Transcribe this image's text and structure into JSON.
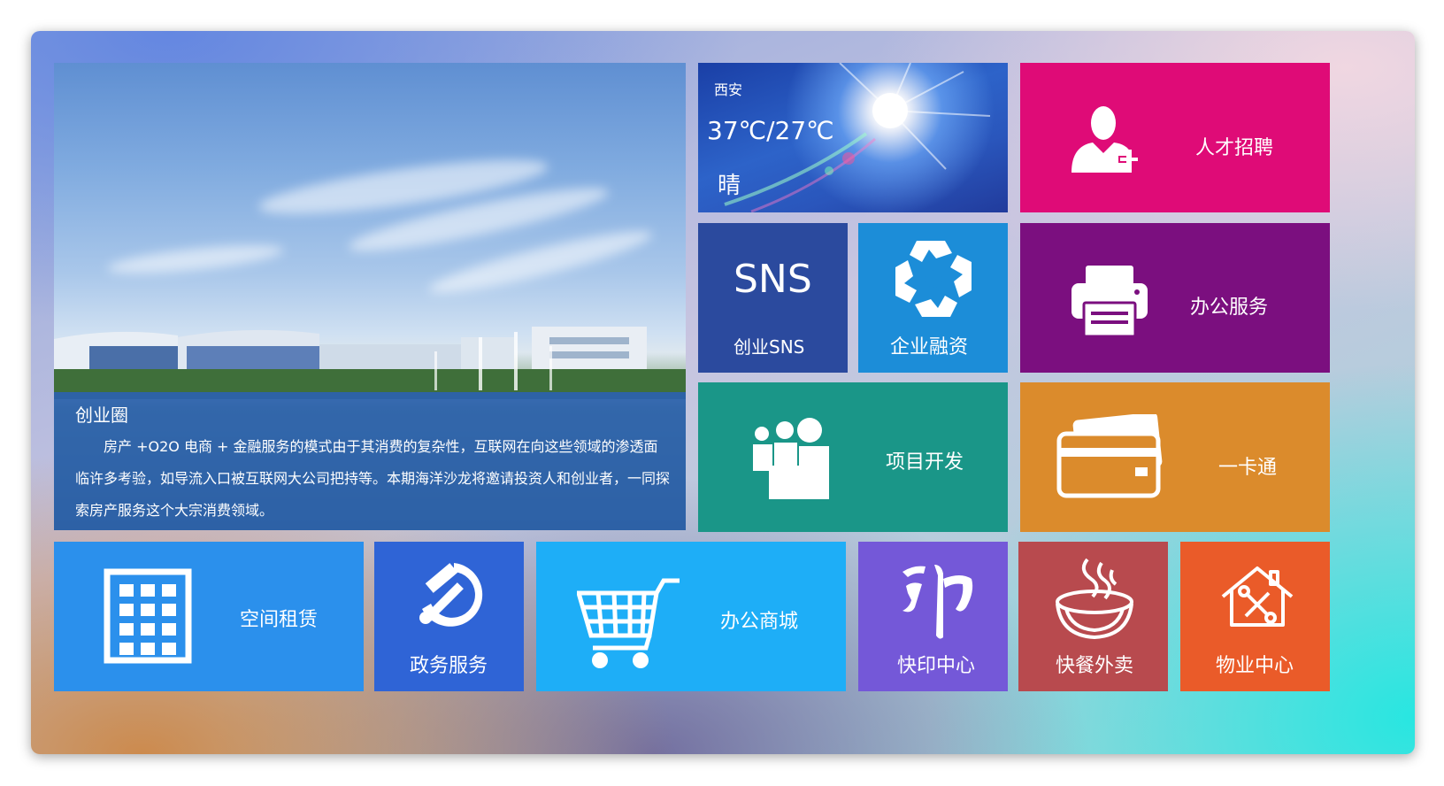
{
  "hero": {
    "title": "创业圈",
    "body": "房产 +O2O 电商 + 金融服务的模式由于其消费的复杂性，互联网在向这些领域的渗透面临许多考验，如导流入口被互联网大公司把持等。本期海洋沙龙将邀请投资人和创业者，一同探索房产服务这个大宗消费领域。"
  },
  "weather": {
    "city": "西安",
    "temp": "37℃/27℃",
    "condition": "晴"
  },
  "tiles": {
    "talent": {
      "label": "人才招聘",
      "icon": "user-add-icon",
      "color": "#df0b77"
    },
    "sns": {
      "big": "SNS",
      "label": "创业SNS",
      "color": "#2b4a9e"
    },
    "finance": {
      "label": "企业融资",
      "icon": "handshake-icon",
      "color": "#1c8dd8"
    },
    "office_service": {
      "label": "办公服务",
      "icon": "printer-icon",
      "color": "#7b0f7f"
    },
    "project": {
      "label": "项目开发",
      "icon": "people-group-icon",
      "color": "#1a9688"
    },
    "card": {
      "label": "一卡通",
      "icon": "card-icon",
      "color": "#db8b2c"
    },
    "rental": {
      "label": "空间租赁",
      "icon": "building-icon",
      "color": "#2b90ec"
    },
    "gov": {
      "label": "政务服务",
      "icon": "hammer-sickle-icon",
      "color": "#2f64d6"
    },
    "mall": {
      "label": "办公商城",
      "icon": "cart-icon",
      "color": "#1eaef7"
    },
    "print": {
      "label": "快印中心",
      "icon": "print-glyph-icon",
      "color": "#7458d8"
    },
    "food": {
      "label": "快餐外卖",
      "icon": "bowl-icon",
      "color": "#b84a4e"
    },
    "property": {
      "label": "物业中心",
      "icon": "house-tools-icon",
      "color": "#ea5b29"
    }
  }
}
